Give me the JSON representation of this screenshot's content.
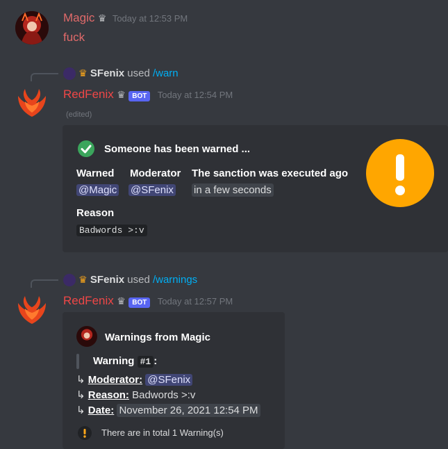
{
  "message1": {
    "username": "Magic",
    "crown_icon": "crown-icon",
    "timestamp": "Today at 12:53 PM",
    "content": "fuck"
  },
  "message2": {
    "reply": {
      "user": "SFenix",
      "used_text": "used",
      "command": "/warn"
    },
    "username": "RedFenix",
    "bot_tag": "BOT",
    "timestamp": "Today at 12:54 PM",
    "edited": "(edited)",
    "embed": {
      "title": "Someone has been warned ...",
      "fields": [
        {
          "name": "Warned",
          "value": "@Magic"
        },
        {
          "name": "Moderator",
          "value": "@SFenix"
        },
        {
          "name": "The sanction was executed ago",
          "value": "in a few seconds"
        }
      ],
      "reason_label": "Reason",
      "reason_value": "Badwords >:v",
      "thumbnail": "exclamation-icon",
      "accent_color": "#ffa600"
    }
  },
  "message3": {
    "reply": {
      "user": "SFenix",
      "used_text": "used",
      "command": "/warnings"
    },
    "username": "RedFenix",
    "bot_tag": "BOT",
    "timestamp": "Today at 12:57 PM",
    "embed": {
      "author": "Warnings from Magic",
      "warning_label": "Warning",
      "warning_number": "#1",
      "warning_colon": ":",
      "arrow": "↳",
      "moderator_label": "Moderator:",
      "moderator_value": "@SFenix",
      "reason_label": "Reason:",
      "reason_value": "Badwords >:v",
      "date_label": "Date:",
      "date_value": "November 26, 2021 12:54 PM",
      "footer": "There are in total 1 Warning(s)"
    }
  },
  "colors": {
    "magic_name": "#e16a6a",
    "redfenix_name": "#f04747",
    "check_green": "#3ba55c"
  }
}
